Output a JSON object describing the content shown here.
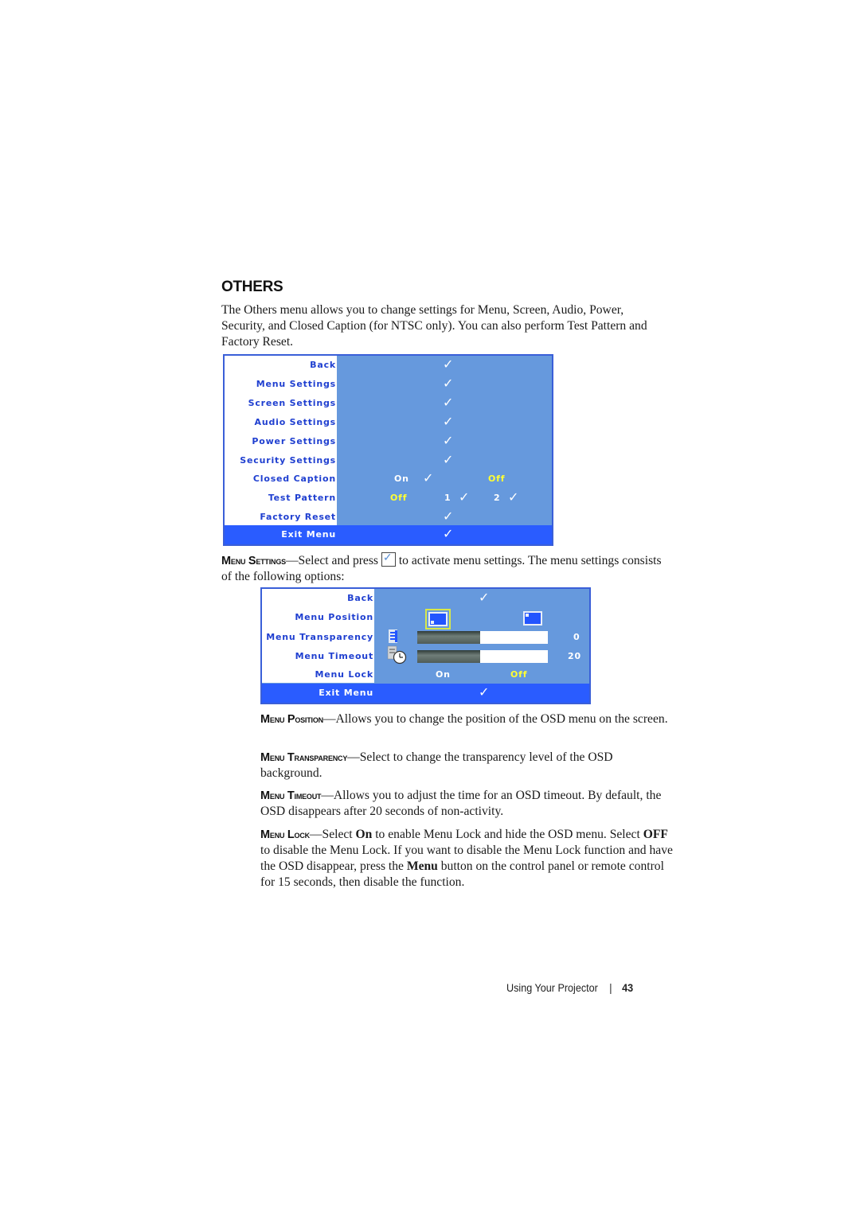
{
  "section": {
    "title": "OTHERS",
    "intro": "The Others menu allows you to change settings for Menu, Screen, Audio, Power, Security, and Closed Caption (for NTSC only). You can also perform Test Pattern and Factory Reset."
  },
  "osd_others": {
    "colors": {
      "panel": "#6699dd",
      "label_text": "#1f3fd0",
      "selected_value": "#ffff33",
      "exit_bar": "#2a5cff",
      "border": "#3a5fd8"
    },
    "rows": [
      {
        "label": "Back",
        "check": "✓"
      },
      {
        "label": "Menu Settings",
        "check": "✓"
      },
      {
        "label": "Screen Settings",
        "check": "✓"
      },
      {
        "label": "Audio Settings",
        "check": "✓"
      },
      {
        "label": "Power Settings",
        "check": "✓"
      },
      {
        "label": "Security Settings",
        "check": "✓"
      },
      {
        "label": "Closed Caption",
        "on": "On",
        "off": "Off",
        "selected": "Off"
      },
      {
        "label": "Test Pattern",
        "off": "Off",
        "opt1": "1",
        "opt2": "2",
        "selected": "Off"
      },
      {
        "label": "Factory Reset",
        "check": "✓"
      },
      {
        "label": "Exit Menu",
        "check": "✓"
      }
    ]
  },
  "menu_settings_para": {
    "lead": "Menu Settings",
    "before_icon": "—Select and press",
    "after_icon": "to activate menu settings. The menu settings consists of the following options:",
    "icon": "check-button-icon"
  },
  "osd_menu": {
    "rows": [
      {
        "label": "Back",
        "check": "✓"
      },
      {
        "label": "Menu Position",
        "options": [
          "bottom-left-icon",
          "top-left-icon"
        ],
        "selected_index": 0
      },
      {
        "label": "Menu Transparency",
        "value": "0",
        "slider_fraction": 0.48,
        "icon": "transparency-icon"
      },
      {
        "label": "Menu Timeout",
        "value": "20",
        "slider_fraction": 0.48,
        "icon": "timeout-clock-icon"
      },
      {
        "label": "Menu Lock",
        "on": "On",
        "off": "Off",
        "selected": "Off"
      },
      {
        "label": "Exit Menu",
        "check": "✓"
      }
    ]
  },
  "descriptions": [
    {
      "lead": "Menu Position",
      "text": "—Allows you to change the position of the OSD menu on the screen."
    },
    {
      "lead": "Menu Transparency",
      "text": "—Select to change the transparency level of the OSD background."
    },
    {
      "lead": "Menu Timeout",
      "text": "—Allows you to adjust the time for an OSD timeout. By default, the OSD disappears after 20 seconds of non-activity."
    },
    {
      "lead": "Menu Lock",
      "t1": "—Select ",
      "b1": "On",
      "t2": " to enable Menu Lock and hide the OSD menu. Select ",
      "b2": "OFF",
      "t3": " to disable the Menu Lock. If you want to disable the Menu Lock function and have the OSD disappear, press the ",
      "b3": "Menu",
      "t4": " button on the control panel or remote control for 15 seconds, then disable the function."
    }
  ],
  "footer": {
    "chapter": "Using Your Projector",
    "separator": "|",
    "page": "43"
  }
}
